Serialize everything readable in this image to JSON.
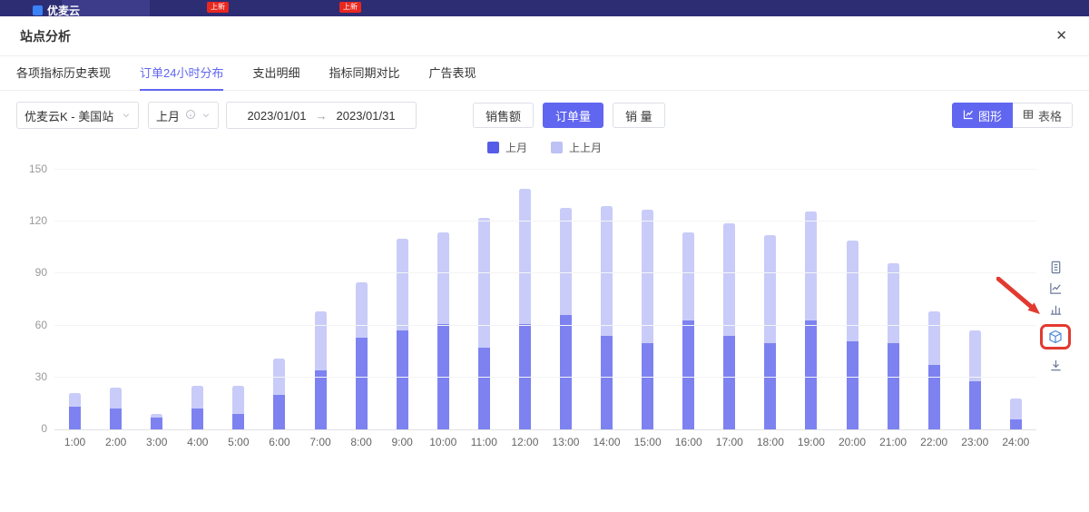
{
  "topbar": {
    "logo": "优麦云",
    "badges": [
      "上新",
      "上新"
    ]
  },
  "modal": {
    "title": "站点分析",
    "close_icon": "✕"
  },
  "tabs": [
    {
      "label": "各项指标历史表现",
      "active": false
    },
    {
      "label": "订单24小时分布",
      "active": true
    },
    {
      "label": "支出明细",
      "active": false
    },
    {
      "label": "指标同期对比",
      "active": false
    },
    {
      "label": "广告表现",
      "active": false
    }
  ],
  "filters": {
    "site_select": {
      "value": "优麦云K - 美国站"
    },
    "period_select": {
      "value": "上月"
    },
    "date_range": {
      "start": "2023/01/01",
      "separator": "→",
      "end": "2023/01/31"
    },
    "metric_buttons": [
      {
        "label": "销售额",
        "active": false
      },
      {
        "label": "订单量",
        "active": true
      },
      {
        "label": "销 量",
        "active": false
      }
    ],
    "view_toggle": [
      {
        "label": "图形",
        "active": true,
        "icon": "line-chart-icon"
      },
      {
        "label": "表格",
        "active": false,
        "icon": "table-icon"
      }
    ]
  },
  "legend": [
    {
      "label": "上月",
      "color": "#575ce8"
    },
    {
      "label": "上上月",
      "color": "#bdc1f3"
    }
  ],
  "chart_data": {
    "type": "bar",
    "stacked": true,
    "title": "",
    "xlabel": "",
    "ylabel": "",
    "categories": [
      "1:00",
      "2:00",
      "3:00",
      "4:00",
      "5:00",
      "6:00",
      "7:00",
      "8:00",
      "9:00",
      "10:00",
      "11:00",
      "12:00",
      "13:00",
      "14:00",
      "15:00",
      "16:00",
      "17:00",
      "18:00",
      "19:00",
      "20:00",
      "21:00",
      "22:00",
      "23:00",
      "24:00"
    ],
    "series": [
      {
        "name": "上月",
        "color": "#7d82f0",
        "values": [
          13,
          12,
          7,
          12,
          9,
          20,
          34,
          53,
          57,
          61,
          47,
          61,
          66,
          54,
          50,
          63,
          54,
          50,
          63,
          51,
          50,
          37,
          28,
          6
        ]
      },
      {
        "name": "上上月",
        "color": "#c9ccf8",
        "values": [
          8,
          12,
          2,
          13,
          16,
          21,
          34,
          32,
          53,
          53,
          75,
          78,
          62,
          75,
          77,
          51,
          65,
          62,
          63,
          58,
          46,
          31,
          29,
          12
        ]
      }
    ],
    "ylim": [
      0,
      150
    ],
    "yticks": [
      0,
      30,
      60,
      90,
      120,
      150
    ],
    "grid": true,
    "legend_position": "top"
  },
  "side_toolbar": {
    "icons": [
      "document-icon",
      "line-chart-icon",
      "bar-chart-icon",
      "cube-icon",
      "download-icon"
    ],
    "highlighted": "cube-icon",
    "highlight_color": "#e23a30",
    "annotation": "red-arrow-pointing-to-cube-icon"
  },
  "colors": {
    "accent": "#6166f0",
    "topbar_bg": "#2d2d74",
    "bar_dark": "#7d82f0",
    "bar_light": "#c9ccf8"
  }
}
